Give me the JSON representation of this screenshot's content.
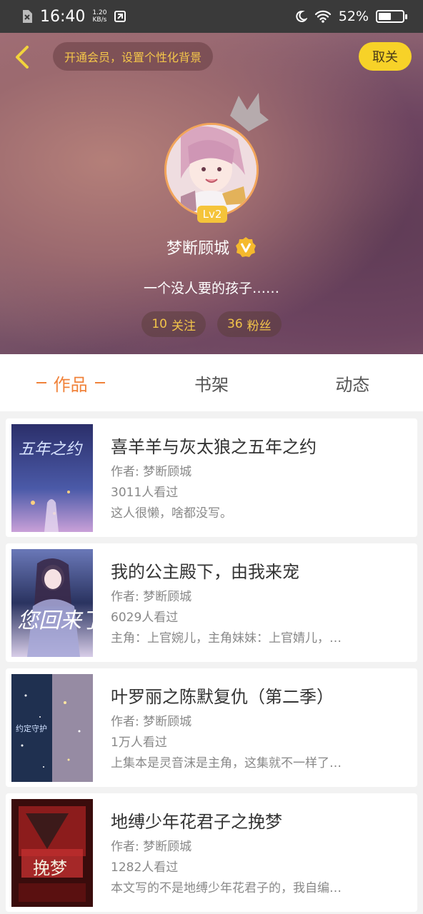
{
  "status_bar": {
    "time": "16:40",
    "net_speed": "1.20",
    "net_unit": "KB/s",
    "battery": "52%",
    "battery_level": 0.52
  },
  "header": {
    "vip_prompt": "开通会员，设置个性化背景",
    "cancel_label": "取关",
    "level": "Lv2",
    "nickname": "梦断顾城",
    "bio": "一个没人要的孩子……",
    "following": {
      "count": "10",
      "label": "关注"
    },
    "followers": {
      "count": "36",
      "label": "粉丝"
    }
  },
  "tabs": [
    {
      "label": "作品",
      "active": true
    },
    {
      "label": "书架",
      "active": false
    },
    {
      "label": "动态",
      "active": false
    }
  ],
  "books": [
    {
      "title": "喜羊羊与灰太狼之五年之约",
      "author": "作者: 梦断顾城",
      "views": "3011人看过",
      "desc": "这人很懒，啥都没写。",
      "cover_colors": [
        "#4b5aa8",
        "#2b2f6a",
        "#c9a0d8"
      ]
    },
    {
      "title": "我的公主殿下，由我来宠",
      "author": "作者: 梦断顾城",
      "views": "6029人看过",
      "desc": "主角：上官婉儿，主角妹妹：上官婧儿，…",
      "cover_colors": [
        "#6a78b8",
        "#2a3360",
        "#d8cde8"
      ]
    },
    {
      "title": "叶罗丽之陈默复仇（第二季）",
      "author": "作者: 梦断顾城",
      "views": "1万人看过",
      "desc": "上集本是灵音沫是主角，这集就不一样了…",
      "cover_colors": [
        "#1f3050",
        "#2e4f7a",
        "#c9a6b8"
      ]
    },
    {
      "title": "地缚少年花君子之挽梦",
      "author": "作者: 梦断顾城",
      "views": "1282人看过",
      "desc": "本文写的不是地缚少年花君子的，我自编…",
      "cover_colors": [
        "#8c1c1c",
        "#3a0c0c",
        "#e5b040"
      ]
    }
  ],
  "colors": {
    "accent": "#f0823a",
    "gold": "#f2c44a",
    "cancel_bg": "#f7d228"
  }
}
